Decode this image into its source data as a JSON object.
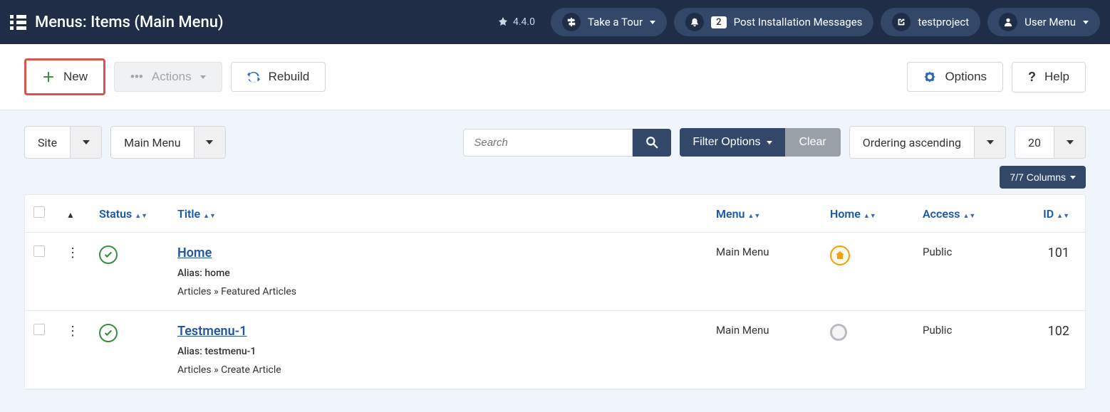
{
  "header": {
    "title": "Menus: Items (Main Menu)",
    "version": "4.4.0",
    "tour_label": "Take a Tour",
    "notifications_count": "2",
    "post_install_label": "Post Installation Messages",
    "project_label": "testproject",
    "user_menu_label": "User Menu"
  },
  "toolbar": {
    "new_label": "New",
    "actions_label": "Actions",
    "rebuild_label": "Rebuild",
    "options_label": "Options",
    "help_label": "Help"
  },
  "filters": {
    "client_select": "Site",
    "menu_select": "Main Menu",
    "search_placeholder": "Search",
    "filter_options_label": "Filter Options",
    "clear_label": "Clear",
    "ordering_label": "Ordering ascending",
    "limit_label": "20",
    "columns_label": "7/7 Columns"
  },
  "table": {
    "headers": {
      "status": "Status",
      "title": "Title",
      "menu": "Menu",
      "home": "Home",
      "access": "Access",
      "id": "ID"
    },
    "rows": [
      {
        "title": "Home",
        "alias": "Alias: home",
        "path": "Articles » Featured Articles",
        "menu": "Main Menu",
        "is_default_home": true,
        "access": "Public",
        "id": "101"
      },
      {
        "title": "Testmenu-1",
        "alias": "Alias: testmenu-1",
        "path": "Articles » Create Article",
        "menu": "Main Menu",
        "is_default_home": false,
        "access": "Public",
        "id": "102"
      }
    ]
  }
}
